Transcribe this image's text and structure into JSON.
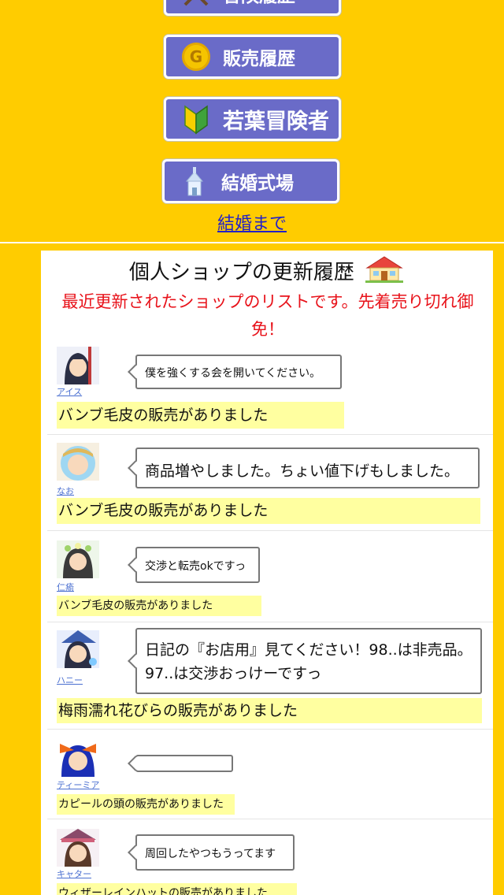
{
  "menu": {
    "top_button_label": "冒険履歴",
    "sales_history_label": "販売履歴",
    "beginner_label": "若葉冒険者",
    "wedding_hall_label": "結婚式場",
    "coin_letter": "G",
    "until_marriage_link": "結婚まで"
  },
  "shop_panel": {
    "title": "個人ショップの更新履歴",
    "notice": "最近更新されたショップのリストです。先着売り切れ御免！"
  },
  "entries": [
    {
      "user": "アイス",
      "message": "僕を強くする会を開いてください。",
      "sale": "バンブ毛皮の販売がありました"
    },
    {
      "user": "なお",
      "message": "商品増やしました。ちょい値下げもしました。",
      "sale": "バンブ毛皮の販売がありました"
    },
    {
      "user": "仁瘉",
      "message": "交渉と転売okですっ",
      "sale": "バンブ毛皮の販売がありました"
    },
    {
      "user": "ハニー",
      "message": "日記の『お店用』見てください！98..は非売品。97..は交渉おっけーですっ",
      "sale": "梅雨濡れ花びらの販売がありました"
    },
    {
      "user": "ティーミア",
      "message": "",
      "sale": "カピールの頭の販売がありました"
    },
    {
      "user": "キャター",
      "message": "周回したやつもうってます",
      "sale": "ウィザーレインハットの販売がありました"
    }
  ],
  "colors": {
    "page_background": "#FFCC00",
    "button_fill": "#6A6BC8",
    "notice_red": "#E8121A",
    "link_blue": "#2321C8",
    "sale_highlight": "#FFFFA0"
  }
}
